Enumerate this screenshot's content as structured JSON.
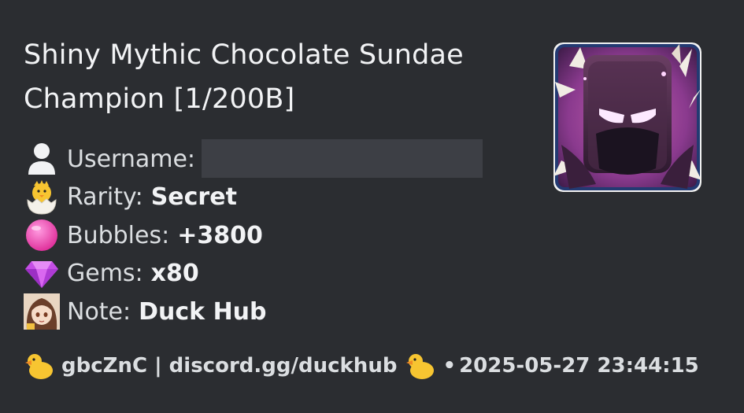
{
  "embed": {
    "title": "Shiny Mythic Chocolate Sundae Champion [1/200B]",
    "fields": [
      {
        "icon": "user-icon",
        "label": "Username:",
        "value": ""
      },
      {
        "icon": "hatching-chick-icon",
        "label": "Rarity:",
        "value": "Secret"
      },
      {
        "icon": "pink-bubble-icon",
        "label": "Bubbles:",
        "value": "+3800"
      },
      {
        "icon": "gem-icon",
        "label": "Gems:",
        "value": "x80"
      },
      {
        "icon": "anime-avatar-icon",
        "label": "Note:",
        "value": "Duck Hub"
      }
    ],
    "thumbnail": {
      "icon": "pet-thumbnail-icon"
    },
    "footer": {
      "text": "gbcZnC | discord.gg/duckhub",
      "separator": "•",
      "timestamp": "2025-05-27 23:44:15",
      "icon": "duck-icon"
    }
  },
  "colors": {
    "background": "#2b2d31",
    "text": "#dbdee1",
    "title": "#f2f3f5",
    "redaction": "#3d3f45"
  }
}
